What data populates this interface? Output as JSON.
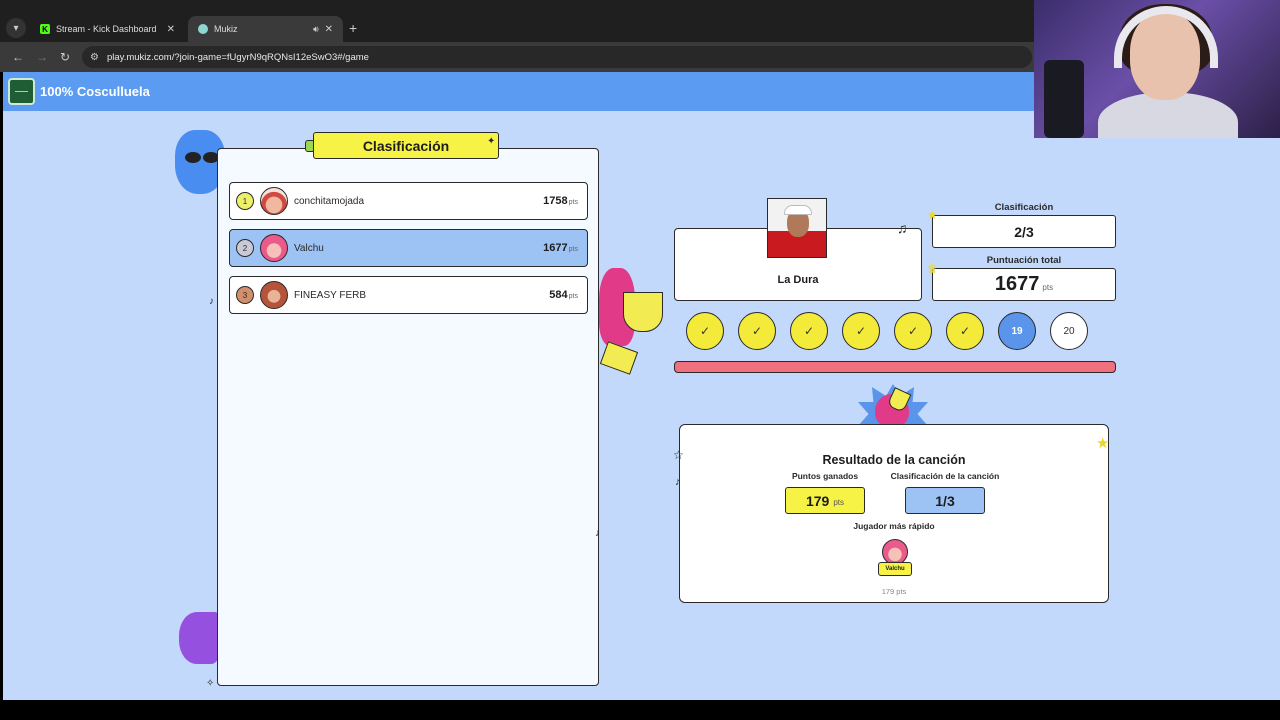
{
  "browser": {
    "tabs": [
      {
        "title": "Stream - Kick Dashboard",
        "favicon": "kick-icon"
      },
      {
        "title": "Mukiz",
        "favicon": "mukiz-icon",
        "audio": true
      }
    ],
    "new_tab_label": "+",
    "url": "play.mukiz.com/?join-game=fUgyrN9qRQNsI12eSwO3#/game"
  },
  "header": {
    "room_title": "100% Cosculluela"
  },
  "leaderboard": {
    "title": "Clasificación",
    "rows": [
      {
        "rank": "1",
        "name": "conchitamojada",
        "score": "1758",
        "unit": "pts",
        "highlight": false
      },
      {
        "rank": "2",
        "name": "Valchu",
        "score": "1677",
        "unit": "pts",
        "highlight": true
      },
      {
        "rank": "3",
        "name": "FINEASY FERB",
        "score": "584",
        "unit": "pts",
        "highlight": false
      }
    ]
  },
  "song": {
    "title": "La Dura"
  },
  "stats": {
    "rank_label": "Clasificación",
    "rank_value": "2/3",
    "total_label": "Puntuación total",
    "total_value": "1677",
    "total_unit": "pts"
  },
  "rounds": {
    "done_count": 6,
    "check_glyph": "✓",
    "current": "19",
    "next": "20"
  },
  "result": {
    "title": "Resultado de la canción",
    "points_label": "Puntos ganados",
    "points_value": "179",
    "points_unit": "pts",
    "song_rank_label": "Clasificación de la canción",
    "song_rank_value": "1/3",
    "fastest_label": "Jugador más rápido",
    "fastest_name": "Valchu",
    "fastest_points": "179 pts"
  },
  "colors": {
    "header_blue": "#5b9cf2",
    "page_bg": "#c3d9fb",
    "yellow": "#f6f246",
    "highlight_blue": "#9dc3f5",
    "progress_red": "#f0707e"
  }
}
